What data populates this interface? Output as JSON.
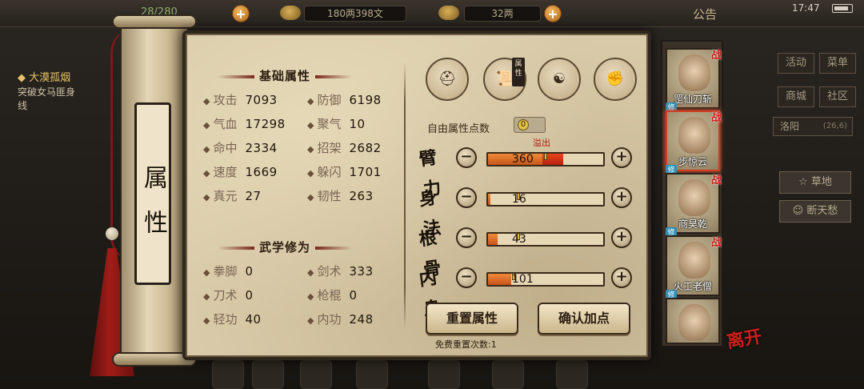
{
  "topbar": {
    "stamina": "28/280",
    "silver": "180两398文",
    "gold": "32两",
    "announcement": "公告",
    "clock": "17:47"
  },
  "quest": {
    "title": "大漠孤烟",
    "desc_line1": "突破女马匪身",
    "desc_line2": "线"
  },
  "right_menu": {
    "activity": "活动",
    "menu": "菜单",
    "shop": "商城",
    "community": "社区",
    "location": "洛阳",
    "coord": "(26,6)",
    "place1": "草地",
    "place2": "断天愁"
  },
  "scroll": {
    "label": "属性"
  },
  "basic": {
    "title": "基础属性",
    "stats": [
      {
        "label": "攻击",
        "value": "7093"
      },
      {
        "label": "防御",
        "value": "6198"
      },
      {
        "label": "气血",
        "value": "17298"
      },
      {
        "label": "聚气",
        "value": "10"
      },
      {
        "label": "命中",
        "value": "2334"
      },
      {
        "label": "招架",
        "value": "2682"
      },
      {
        "label": "速度",
        "value": "1669"
      },
      {
        "label": "躲闪",
        "value": "1701"
      },
      {
        "label": "真元",
        "value": "27"
      },
      {
        "label": "韧性",
        "value": "263"
      }
    ]
  },
  "martial": {
    "title": "武学修为",
    "stats": [
      {
        "label": "拳脚",
        "value": "0"
      },
      {
        "label": "剑术",
        "value": "333"
      },
      {
        "label": "刀术",
        "value": "0"
      },
      {
        "label": "枪棍",
        "value": "0"
      },
      {
        "label": "轻功",
        "value": "40"
      },
      {
        "label": "内功",
        "value": "248"
      }
    ]
  },
  "class_icons": [
    "hat-icon",
    "scroll-icon",
    "taiji-icon",
    "muscle-icon"
  ],
  "class_tag": "属性",
  "free_points_label": "自由属性点数",
  "free_points_value": "0",
  "overflow_label": "溢出",
  "attributes": [
    {
      "name": "臂力",
      "value": "360",
      "fill": 0.47,
      "overflow": 0.18
    },
    {
      "name": "身法",
      "value": "16",
      "fill": 0.02,
      "overflow": 0
    },
    {
      "name": "根骨",
      "value": "43",
      "fill": 0.08,
      "overflow": 0
    },
    {
      "name": "内息",
      "value": "101",
      "fill": 0.2,
      "overflow": 0
    }
  ],
  "buttons": {
    "reset": "重置属性",
    "confirm": "确认加点",
    "free_reset": "免费重置次数:1"
  },
  "heroes": [
    {
      "name": "罡仙刀斩",
      "tag": "战",
      "active": false
    },
    {
      "name": "步惊云",
      "tag": "战",
      "active": true
    },
    {
      "name": "商昊乾",
      "tag": "战",
      "active": false
    },
    {
      "name": "火工老僧",
      "tag": "战",
      "active": false
    },
    {
      "name": "",
      "tag": "",
      "active": false
    }
  ],
  "leave_label": "离开",
  "colors": {
    "accent_red": "#c8201a",
    "bar_orange": "#ee8a3a",
    "parchment": "#d9cba9"
  }
}
